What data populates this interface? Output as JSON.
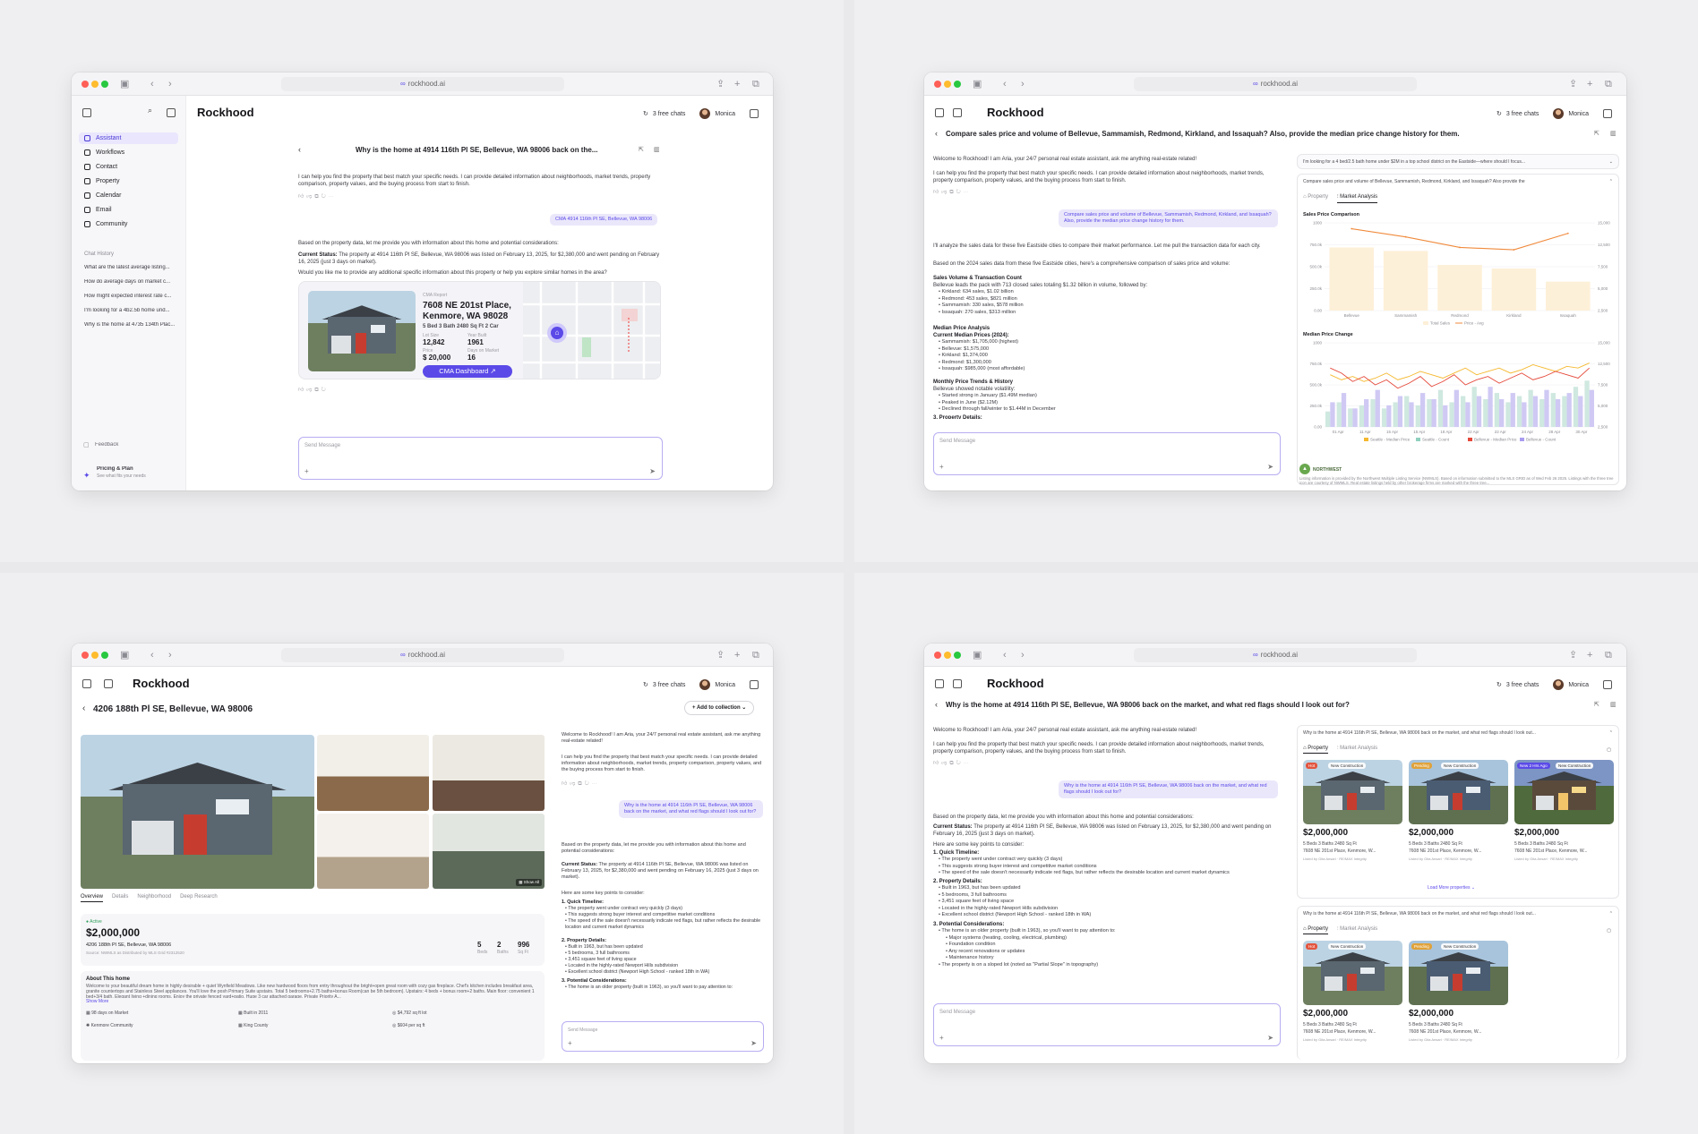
{
  "common": {
    "url": "rockhood.ai",
    "brand": "Rockhood",
    "free_chats": "3 free chats",
    "user": "Monica",
    "send_placeholder": "Send Message"
  },
  "w1": {
    "nav": [
      "Assistant",
      "Workflows",
      "Contact",
      "Property",
      "Calendar",
      "Email",
      "Community"
    ],
    "chat_history_label": "Chat History",
    "history": [
      "What are the latest average listing...",
      "How do average days on market c...",
      "How might expected interest rate c...",
      "I'm looking for a 4b2.5b home und...",
      "Why is the home at 4735 134th Plac..."
    ],
    "feedback": "Feedback",
    "pricing_title": "Pricing & Plan",
    "pricing_sub": "See what fits your needs",
    "title": "Why is the home at 4914 116th Pl SE, Bellevue, WA 98006 back on the...",
    "intro": "I can help you find the property that best match your specific needs. I can provide detailed information about neighborhoods, market trends, property comparison, property values, and the buying process from start to finish.",
    "user_bubble": "CMA 4914 116th Pl SE, Bellevue, WA 98006",
    "p1": "Based on the property data, let me provide you with information about this home and potential considerations:",
    "status_label": "Current Status:",
    "status": "The property at 4914 116th Pl SE, Bellevue, WA 98006 was listed on February 13, 2025, for $2,380,000 and went pending on February 16, 2025 (just 3 days on market).",
    "p2": "Would you like me to provide any additional specific information about this property or help you explore similar homes in the area?",
    "cma": {
      "label": "CMA Report",
      "address1": "7608 NE 201st Place,",
      "address2": "Kenmore, WA 98028",
      "specs": "5 Bed  3 Bath  2480 Sq Ft  2 Car",
      "lot_label": "Lot Size",
      "lot": "12,842",
      "year_label": "Year Built",
      "year": "1961",
      "price_label": "Price",
      "price": "$ 20,000",
      "dom_label": "Days on Market",
      "dom": "16",
      "button": "CMA Dashboard"
    }
  },
  "w2": {
    "title": "Compare sales price and volume of Bellevue, Sammamish, Redmond, Kirkland, and Issaquah? Also, provide the median price change history for them.",
    "welcome": "Welcome to Rockhood! I am Aria, your 24/7 personal real estate assistant, ask me anything real-estate related!",
    "intro": "I can help you find the property that best match your specific needs. I can provide detailed information about neighborhoods, market trends, property comparison, property values, and the buying process from start to finish.",
    "user_bubble": "Compare sales price and volume of Bellevue, Sammamish, Redmond, Kirkland, and Issaquah? Also, provide the median price change history for them.",
    "p1": "I'll analyze the sales data for these five Eastside cities to compare their market performance. Let me pull the transaction data for each city.",
    "p2": "Based on the 2024 sales data from these five Eastside cities, here's a comprehensive comparison of sales price and volume:",
    "h1": "Sales Volume & Transaction Count",
    "h1_text": "Bellevue leads the pack with 713 closed sales totaling $1.32 billion in volume, followed by:",
    "h1_items": [
      "Kirkland: 634 sales, $1.02 billion",
      "Redmond: 453 sales, $821 million",
      "Sammamish: 330 sales, $578 million",
      "Issaquah: 270 sales, $313 million"
    ],
    "h2": "Median Price Analysis",
    "h2_sub": "Current Median Prices (2024):",
    "h2_items": [
      "Sammamish: $1,705,000 (highest)",
      "Bellevue: $1,575,000",
      "Kirkland: $1,374,000",
      "Redmond: $1,300,000",
      "Issaquah: $985,000 (most affordable)"
    ],
    "h3": "Monthly Price Trends & History",
    "h3_text": "Bellevue showed notable volatility:",
    "h3_items": [
      "Started strong in January ($1.49M median)",
      "Peaked in June ($2.12M)",
      "Declined through fall/winter to $1.44M in December"
    ],
    "cut": "3. Property Details:",
    "side_q1": "I'm looking for a 4 bed/2.5 bath home under $2M in a top school district on the Eastside—where should I focus...",
    "side_q2": "Compare sales price and volume of Bellevue, Sammamish, Redmond, Kirkland, and Issaquah? Also provide the",
    "tab_property": "Property",
    "tab_market": "Market Analysis",
    "chart1_title": "Sales Price Comparison",
    "chart2_title": "Median Price Change",
    "legend1": [
      "Total Sales",
      "Price - Avg"
    ],
    "legend2": [
      "Seattle - Median Price",
      "Seattle - Count",
      "Bellevue - Median Price",
      "Bellevue - Count"
    ],
    "nwmls": "NORTHWEST",
    "disclaimer": "Listing information is provided by the Northwest Multiple Listing Service (NWMLS). Based on information submitted to the MLS GRID as of Wed Feb 26 2025. Listings with the three tree icon are courtesy of NWMLS. Real estate listings held by other brokerage firms are marked with the three tree..."
  },
  "w3": {
    "address_title": "4206 188th  Pl SE, Bellevue, WA 98006",
    "add_collection": "Add to collection",
    "tabs": [
      "Overview",
      "Details",
      "Neighborhood",
      "Deep Research"
    ],
    "status": "Active",
    "price": "$2,000,000",
    "address": "4206 188th  Pl SE, Bellevue, WA 98006",
    "source": "Source: NWMLS as Distributed by MLS Grid #2312520",
    "beds": "5",
    "beds_label": "Beds",
    "baths": "2",
    "baths_label": "Baths",
    "sqft": "996",
    "sqft_label": "Sq Ft",
    "about_title": "About This home",
    "about": "Welcome to your beautiful dream home in highly desirable + quiet Wynfield Meadows. Like new hardwood floors from entry throughout the bright+open great room with cozy gas fireplace. Chef's kitchen includes breakfast area, granite countertops and Stainless Steel appliances. You'll love the posh Primary Suite upstairs. Total 5 bedrooms+2.75 baths+bonus Room(can be 5th bedroom). Upstairs: 4 beds + bonus room+2 baths. Main floor: convenient 1 bed+3/4 bath. Elegant living +dining rooms. Enjoy the private fenced yard+patio. Huge 3 car attached garage. Private Priority A...",
    "show_more": "Show More",
    "facts": [
      "98 days on Market",
      "Built in 2011",
      "$4,792 sq ft lot",
      "Kenmore Community",
      "King County",
      "$604 per sq ft"
    ],
    "show_all": "Show All",
    "welcome": "Welcome to Rockhood! I am Aria, your 24/7 personal real estate assistant, ask me anything real-estate related!",
    "intro": "I can help you find the property that best match your specific needs. I can provide detailed information about neighborhoods, market trends, property comparison, property values, and the buying process from start to finish.",
    "user_bubble": "Why is the home at 4914 116th Pl SE, Bellevue, WA 98006 back on the market, and what red flags should I look out for?",
    "p1": "Based on the property data, let me provide you with information about this home and potential considerations:",
    "status_label": "Current Status:",
    "status_text": "The property at 4914 116th Pl SE, Bellevue, WA 98006 was listed on February 13, 2025, for $2,380,000 and went pending on February 16, 2025 (just 3 days on market).",
    "p2": "Here are some key points to consider:",
    "s1": "1. Quick Timeline:",
    "s1_items": [
      "The property went under contract very quickly (3 days)",
      "This suggests strong buyer interest and competitive market conditions",
      "The speed of the sale doesn't necessarily indicate red flags, but rather reflects the desirable location and current market dynamics"
    ],
    "s2": "2. Property Details:",
    "s2_items": [
      "Built in 1963, but has been updated",
      "5 bedrooms, 3 full bathrooms",
      "3,451 square feet of living space",
      "Located in the highly-rated Newport Hills subdivision",
      "Excellent school district (Newport High School - ranked 18th in WA)"
    ],
    "s3": "3. Potential Considerations:",
    "s3_items": [
      "The home is an older property (built in 1963), so you'll want to pay attention to:"
    ]
  },
  "w4": {
    "title": "Why is the home at 4914 116th Pl SE, Bellevue, WA 98006 back on the market, and what red flags should I look out for?",
    "welcome": "Welcome to Rockhood! I am Aria, your 24/7 personal real estate assistant, ask me anything real-estate related!",
    "intro": "I can help you find the property that best match your specific needs. I can provide detailed information about neighborhoods, market trends, property comparison, property values, and the buying process from start to finish.",
    "user_bubble": "Why is the home at 4914 116th Pl SE, Bellevue, WA 98006 back on the market, and what red flags should I look out for?",
    "p1": "Based on the property data, let me provide you with information about this home and potential considerations:",
    "status_label": "Current Status:",
    "status_text": "The property at 4914 116th Pl SE, Bellevue, WA 98006 was listed on February 13, 2025, for $2,380,000 and went pending on February 16, 2025 (just 3 days on market).",
    "p2": "Here are some key points to consider:",
    "s1": "1. Quick Timeline:",
    "s1_items": [
      "The property went under contract very quickly (3 days)",
      "This suggests strong buyer interest and competitive market conditions",
      "The speed of the sale doesn't necessarily indicate red flags, but rather reflects the desirable location and current market dynamics"
    ],
    "s2": "2. Property Details:",
    "s2_items": [
      "Built in 1963, but has been updated",
      "5 bedrooms, 3 full bathrooms",
      "3,451 square feet of living space",
      "Located in the highly-rated Newport Hills subdivision",
      "Excellent school district (Newport High School - ranked 18th in WA)"
    ],
    "s3": "3. Potential Considerations:",
    "s3_items": [
      "The home is an older property (built in 1963), so you'll want to pay attention to:",
      "Major systems (heating, cooling, electrical, plumbing)",
      "Foundation condition",
      "Any recent renovations or updates",
      "Maintenance history",
      "The property is on a sloped lot (noted as \"Partial Slope\" in topography)"
    ],
    "side_q": "Why is the home at 4914 116th Pl SE, Bellevue, WA 98006 back on the market, and what red flags should I look out...",
    "tab_property": "Property",
    "tab_market": "Market Analysis",
    "listings": [
      {
        "badge1": "Hot",
        "badge2": "New Construction",
        "price": "$2,000,000",
        "specs": "5 Beds   3 Baths   2480 Sq Ft",
        "addr": "7608 NE 201st Place, Kenmore, W...",
        "agent": "Listed by Gita Ansari · RE/MAX Integrity"
      },
      {
        "badge1": "Pending",
        "badge2": "New Construction",
        "price": "$2,000,000",
        "specs": "5 Beds   3 Baths   2480 Sq Ft",
        "addr": "7608 NE 201st Place, Kenmore, W...",
        "agent": "Listed by Gita Ansari · RE/MAX Integrity"
      },
      {
        "badge1": "New 2 Hrs Ago",
        "badge2": "New Construction",
        "price": "$2,000,000",
        "specs": "5 Beds   3 Baths   2480 Sq Ft",
        "addr": "7608 NE 201st Place, Kenmore, W...",
        "agent": "Listed by Gita Ansari · RE/MAX Integrity"
      }
    ],
    "load_more": "Load More properties"
  },
  "chart_data": [
    {
      "type": "bar",
      "title": "Sales Price Comparison",
      "categories": [
        "Bellevue",
        "Sammamish",
        "Redmond",
        "Kirkland",
        "Issaquah"
      ],
      "series": [
        {
          "name": "Total Sales",
          "type": "bar",
          "values": [
            720,
            680,
            520,
            480,
            330
          ]
        },
        {
          "name": "Price - Avg",
          "type": "line",
          "values": [
            14000,
            12600,
            10800,
            10400,
            13200
          ]
        }
      ],
      "ylim": [
        0,
        1000
      ],
      "y2lim": [
        0,
        15000
      ],
      "yticks": [
        "1000",
        "750.0k",
        "500.0k",
        "250.0k",
        "0.00"
      ],
      "y2ticks": [
        "15,000",
        "12,500",
        "7,500",
        "5,000",
        "2,500"
      ]
    },
    {
      "type": "line",
      "title": "Median Price Change",
      "categories": [
        "01 Apr",
        "11 Apr",
        "15 Apr",
        "15 Apr",
        "18 Apr",
        "22 Apr",
        "22 Apr",
        "24 Apr",
        "28 Apr",
        "30 Apr"
      ],
      "series": [
        {
          "name": "Seattle - Median Price",
          "values": [
            620,
            560,
            600,
            540,
            580,
            640,
            560,
            600,
            660,
            620,
            580,
            640,
            700,
            620,
            660,
            700,
            640,
            680,
            740,
            700,
            660,
            720,
            700,
            760
          ]
        },
        {
          "name": "Seattle - Count",
          "values": [
            5,
            8,
            6,
            7,
            9,
            6,
            8,
            10,
            7,
            9,
            12,
            8,
            10,
            13,
            9,
            11,
            8,
            10,
            12,
            9,
            11,
            10,
            13,
            15
          ]
        },
        {
          "name": "Bellevue - Median Price",
          "values": [
            700,
            640,
            540,
            600,
            500,
            560,
            460,
            520,
            600,
            480,
            540,
            620,
            500,
            560,
            600,
            520,
            580,
            640,
            560,
            600,
            660,
            620,
            580,
            700
          ]
        },
        {
          "name": "Bellevue - Count",
          "values": [
            8,
            11,
            6,
            9,
            12,
            7,
            10,
            8,
            11,
            9,
            7,
            12,
            8,
            10,
            13,
            9,
            11,
            8,
            10,
            12,
            9,
            11,
            10,
            12
          ]
        }
      ],
      "ylim": [
        0,
        1000
      ],
      "yticks": [
        "1000",
        "750.0k",
        "500.0k",
        "250.0k",
        "0.00"
      ],
      "y2ticks": [
        "15,000",
        "12,500",
        "7,500",
        "5,000",
        "2,500"
      ]
    }
  ]
}
